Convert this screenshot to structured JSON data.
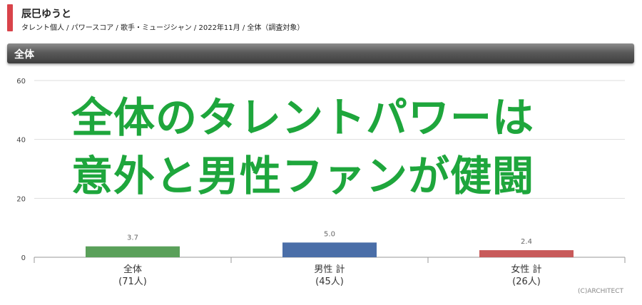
{
  "header": {
    "title": "辰巳ゆうと",
    "subtitle": "タレント個人 / パワースコア / 歌手・ミュージシャン / 2022年11月 / 全体（調査対象）"
  },
  "section": {
    "label": "全体"
  },
  "overlay": {
    "line1": "全体のタレントパワーは",
    "line2": "意外と男性ファンが健闘"
  },
  "credit": "(C)ARCHITECT",
  "chart_data": {
    "type": "bar",
    "categories": [
      "全体",
      "男性 計",
      "女性 計"
    ],
    "category_counts": [
      "(71人)",
      "(45人)",
      "(26人)"
    ],
    "values": [
      3.7,
      5.0,
      2.4
    ],
    "value_labels": [
      "3.7",
      "5.0",
      "2.4"
    ],
    "colors": [
      "#5aa05a",
      "#4a6ea8",
      "#c85a5a"
    ],
    "ylim": [
      0,
      60
    ],
    "yticks": [
      0,
      20,
      40,
      60
    ],
    "grid": true,
    "title": "",
    "xlabel": "",
    "ylabel": ""
  }
}
